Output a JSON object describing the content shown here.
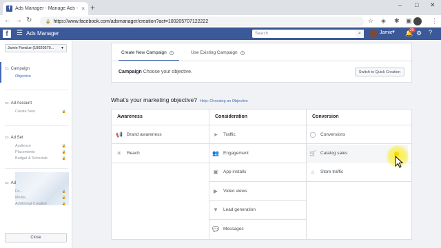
{
  "browser": {
    "tab_title": "Ads Manager - Manage Ads - Ca",
    "tab_close": "×",
    "new_tab": "+",
    "url": "https://www.facebook.com/adsmanager/creation?act=100205707122222",
    "win_min": "–",
    "win_max": "□",
    "win_close": "✕"
  },
  "fbbar": {
    "title": "Ads Manager",
    "search_placeholder": "Search",
    "user_name": "Jamie",
    "notif_count": "20"
  },
  "sidebar": {
    "account": "Jamie Fondue (10020570...",
    "sections": [
      {
        "title": "Campaign",
        "items": [
          {
            "label": "Objective",
            "locked": false
          }
        ]
      },
      {
        "title": "Ad Account",
        "items": [
          {
            "label": "Create New",
            "locked": true
          }
        ]
      },
      {
        "title": "Ad Set",
        "items": [
          {
            "label": "Audience",
            "locked": true
          },
          {
            "label": "Placements",
            "locked": true
          },
          {
            "label": "Budget & Schedule",
            "locked": true
          }
        ]
      },
      {
        "title": "Ad",
        "items": [
          {
            "label": "Fo...",
            "locked": true
          },
          {
            "label": "Media",
            "locked": true
          },
          {
            "label": "Additional Creative",
            "locked": true
          }
        ]
      }
    ],
    "close_label": "Close"
  },
  "main": {
    "tab_create": "Create New Campaign",
    "tab_existing": "Use Existing Campaign",
    "campaign_label": "Campaign",
    "campaign_hint": "Choose your objective.",
    "quick_button": "Switch to Quick Creation",
    "objective_question": "What's your marketing objective?",
    "objective_help": "Help: Choosing an Objective",
    "columns": [
      {
        "header": "Awareness",
        "items": [
          {
            "label": "Brand awareness",
            "icon": "megaphone-icon"
          },
          {
            "label": "Reach",
            "icon": "asterisk-icon"
          }
        ]
      },
      {
        "header": "Consideration",
        "items": [
          {
            "label": "Traffic",
            "icon": "cursor-icon"
          },
          {
            "label": "Engagement",
            "icon": "people-icon"
          },
          {
            "label": "App installs",
            "icon": "box-icon"
          },
          {
            "label": "Video views",
            "icon": "video-icon"
          },
          {
            "label": "Lead generation",
            "icon": "filter-icon"
          },
          {
            "label": "Messages",
            "icon": "chat-icon"
          }
        ]
      },
      {
        "header": "Conversion",
        "items": [
          {
            "label": "Conversions",
            "icon": "globe-icon"
          },
          {
            "label": "Catalog sales",
            "icon": "cart-icon"
          },
          {
            "label": "Store traffic",
            "icon": "store-icon"
          }
        ]
      }
    ]
  },
  "colors": {
    "fb_blue": "#3b5998",
    "link_blue": "#4267b2",
    "highlight": "#ffeb00"
  }
}
